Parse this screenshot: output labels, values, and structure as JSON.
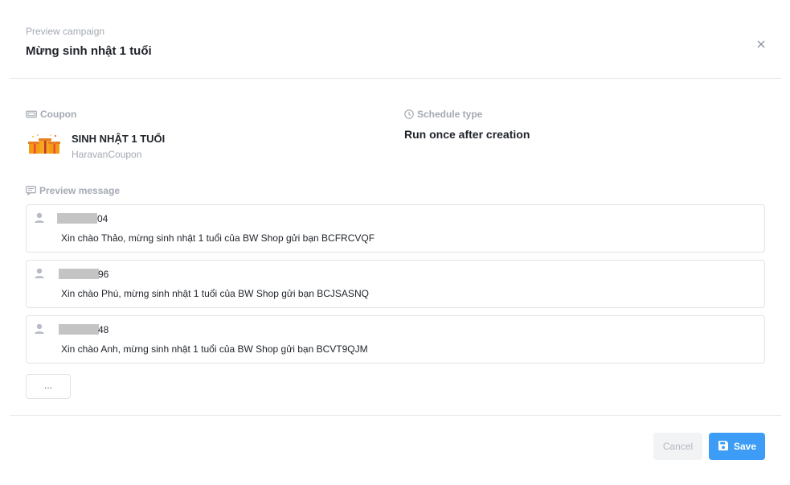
{
  "header": {
    "subtitle": "Preview campaign",
    "title": "Mừng sinh nhật 1 tuổi",
    "close_icon": "close-icon"
  },
  "coupon": {
    "label": "Coupon",
    "icon": "ticket-icon",
    "name": "SINH NHẬT 1 TUỔI",
    "provider": "HaravanCoupon",
    "image": "gift-boxes-icon"
  },
  "schedule": {
    "label": "Schedule type",
    "icon": "clock-icon",
    "value": "Run once after creation"
  },
  "preview": {
    "label": "Preview message",
    "icon": "message-icon",
    "messages": [
      {
        "phone_suffix": "04",
        "text": "Xin chào Thảo, mừng sinh nhật 1 tuổi của BW Shop gửi bạn BCFRCVQF"
      },
      {
        "phone_suffix": "96",
        "text": "Xin chào Phú, mừng sinh nhật 1 tuổi của BW Shop gửi bạn BCJSASNQ"
      },
      {
        "phone_suffix": "48",
        "text": "Xin chào Anh, mừng sinh nhật 1 tuổi của BW Shop gửi bạn BCVT9QJM"
      }
    ],
    "more_label": "..."
  },
  "footer": {
    "cancel_label": "Cancel",
    "save_label": "Save",
    "save_icon": "floppy-disk-icon"
  },
  "colors": {
    "primary": "#3d9cf5",
    "muted_text": "#a3a9b3",
    "border": "#e0e3e8"
  }
}
